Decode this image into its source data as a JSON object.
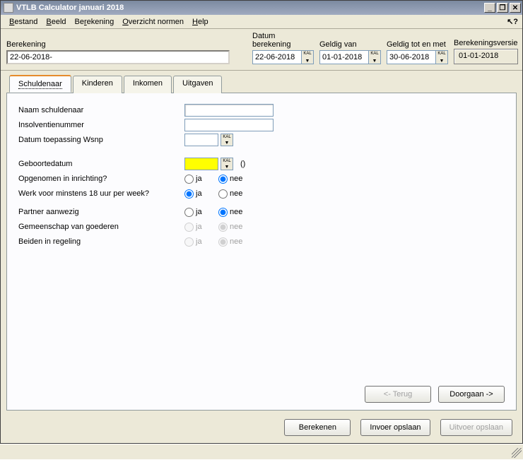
{
  "title": "VTLB Calculator januari 2018",
  "menu": {
    "bestand": "Bestand",
    "beeld": "Beeld",
    "berekening": "Berekening",
    "overzicht": "Overzicht normen",
    "help": "Help"
  },
  "top": {
    "berekening_label": "Berekening",
    "berekening_value": "22-06-2018-",
    "datum_berekening_label": "Datum berekening",
    "datum_berekening_value": "22-06-2018",
    "geldig_van_label": "Geldig van",
    "geldig_van_value": "01-01-2018",
    "geldig_tot_label": "Geldig tot en met",
    "geldig_tot_value": "30-06-2018",
    "versie_label": "Berekeningsversie",
    "versie_value": "01-01-2018"
  },
  "tabs": {
    "schuldenaar": "Schuldenaar",
    "kinderen": "Kinderen",
    "inkomen": "Inkomen",
    "uitgaven": "Uitgaven"
  },
  "form": {
    "naam_label": "Naam schuldenaar",
    "naam_value": "",
    "insolventie_label": "Insolventienummer",
    "insolventie_value": "",
    "datum_wsnp_label": "Datum toepassing Wsnp",
    "datum_wsnp_value": "",
    "geboortedatum_label": "Geboortedatum",
    "geboortedatum_value": "",
    "age_display": "()",
    "yn": {
      "ja": "ja",
      "nee": "nee"
    },
    "opgenomen_label": "Opgenomen in inrichting?",
    "werk18_label": "Werk voor minstens 18 uur per week?",
    "partner_label": "Partner aanwezig",
    "gemeenschap_label": "Gemeenschap van goederen",
    "beiden_label": "Beiden in regeling"
  },
  "buttons": {
    "terug": "<- Terug",
    "doorgaan": "Doorgaan ->",
    "berekenen": "Berekenen",
    "invoer": "Invoer opslaan",
    "uitvoer": "Uitvoer opslaan"
  },
  "winbtns": {
    "min": "_",
    "max": "❐",
    "close": "✕"
  },
  "help_icon": "↖?"
}
